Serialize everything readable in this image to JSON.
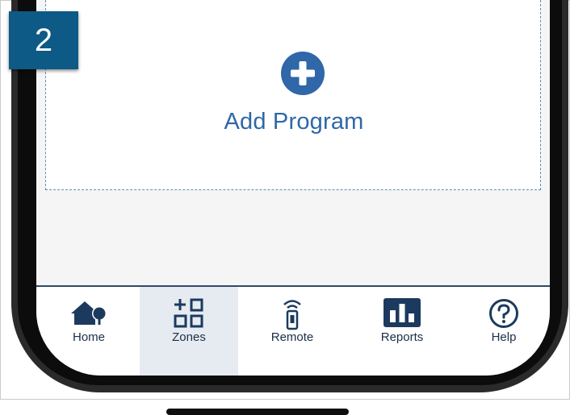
{
  "step_badge": "2",
  "program": {
    "add_label": "Add Program",
    "icon": "plus-circle-icon"
  },
  "tabs": [
    {
      "label": "Home",
      "icon": "house-tree-icon",
      "active": false
    },
    {
      "label": "Zones",
      "icon": "zones-grid-icon",
      "active": true
    },
    {
      "label": "Remote",
      "icon": "remote-control-icon",
      "active": false
    },
    {
      "label": "Reports",
      "icon": "bar-chart-icon",
      "active": false
    },
    {
      "label": "Help",
      "icon": "question-circle-icon",
      "active": false
    }
  ],
  "colors": {
    "accent": "#2f67a8",
    "tab_icon": "#1b3a5e",
    "active_tab_bg": "#e6ebf1",
    "badge_bg": "#0d5a86"
  }
}
